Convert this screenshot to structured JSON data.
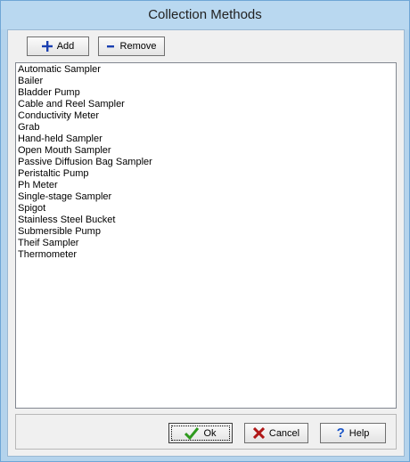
{
  "window": {
    "title": "Collection Methods"
  },
  "toolbar": {
    "add_label": "Add",
    "remove_label": "Remove"
  },
  "list": {
    "items": [
      "Automatic Sampler",
      "Bailer",
      "Bladder Pump",
      "Cable and Reel Sampler",
      "Conductivity Meter",
      "Grab",
      "Hand-held Sampler",
      "Open Mouth Sampler",
      "Passive Diffusion Bag Sampler",
      "Peristaltic Pump",
      "Ph Meter",
      "Single-stage Sampler",
      "Spigot",
      "Stainless Steel Bucket",
      "Submersible Pump",
      "Theif Sampler",
      "Thermometer"
    ]
  },
  "footer": {
    "ok_label": "Ok",
    "cancel_label": "Cancel",
    "help_label": "Help"
  },
  "colors": {
    "add_icon": "#1a3fb0",
    "remove_icon": "#1a3fb0",
    "ok_icon": "#2e9a1e",
    "cancel_icon": "#b01818",
    "help_icon": "#1a55c8"
  },
  "icons": {
    "add": "plus-icon",
    "remove": "minus-icon",
    "ok": "checkmark-icon",
    "cancel": "x-icon",
    "help": "question-icon"
  }
}
